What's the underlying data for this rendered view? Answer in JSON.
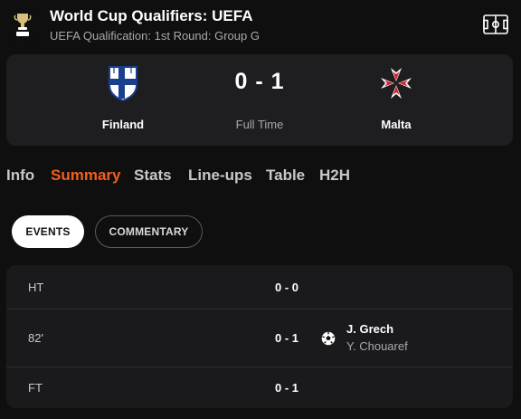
{
  "competition": {
    "title": "World Cup Qualifiers: UEFA",
    "subtitle": "UEFA Qualification: 1st Round: Group G",
    "logo_icon": "trophy-icon",
    "pitch_icon": "pitch-icon"
  },
  "match": {
    "home": {
      "name": "Finland",
      "crest_icon": "finland-flag-crest-icon"
    },
    "away": {
      "name": "Malta",
      "crest_icon": "maltese-cross-icon"
    },
    "score": "0 - 1",
    "status": "Full Time"
  },
  "tabs": [
    {
      "label": "Info",
      "active": false
    },
    {
      "label": "Summary",
      "active": true
    },
    {
      "label": "Stats",
      "active": false
    },
    {
      "label": "Line-ups",
      "active": false
    },
    {
      "label": "Table",
      "active": false
    },
    {
      "label": "H2H",
      "active": false
    }
  ],
  "filters": {
    "events_label": "EVENTS",
    "commentary_label": "COMMENTARY",
    "selected": "EVENTS"
  },
  "events": [
    {
      "minute": "HT",
      "score": "0 - 0"
    },
    {
      "minute": "82'",
      "score": "0 - 1",
      "icon": "football-icon",
      "scorer": "J. Grech",
      "assist": "Y. Chouaref"
    },
    {
      "minute": "FT",
      "score": "0 - 1"
    }
  ],
  "colors": {
    "accent": "#f25f1c",
    "background": "#0f0f10",
    "card": "#1e1e20"
  }
}
